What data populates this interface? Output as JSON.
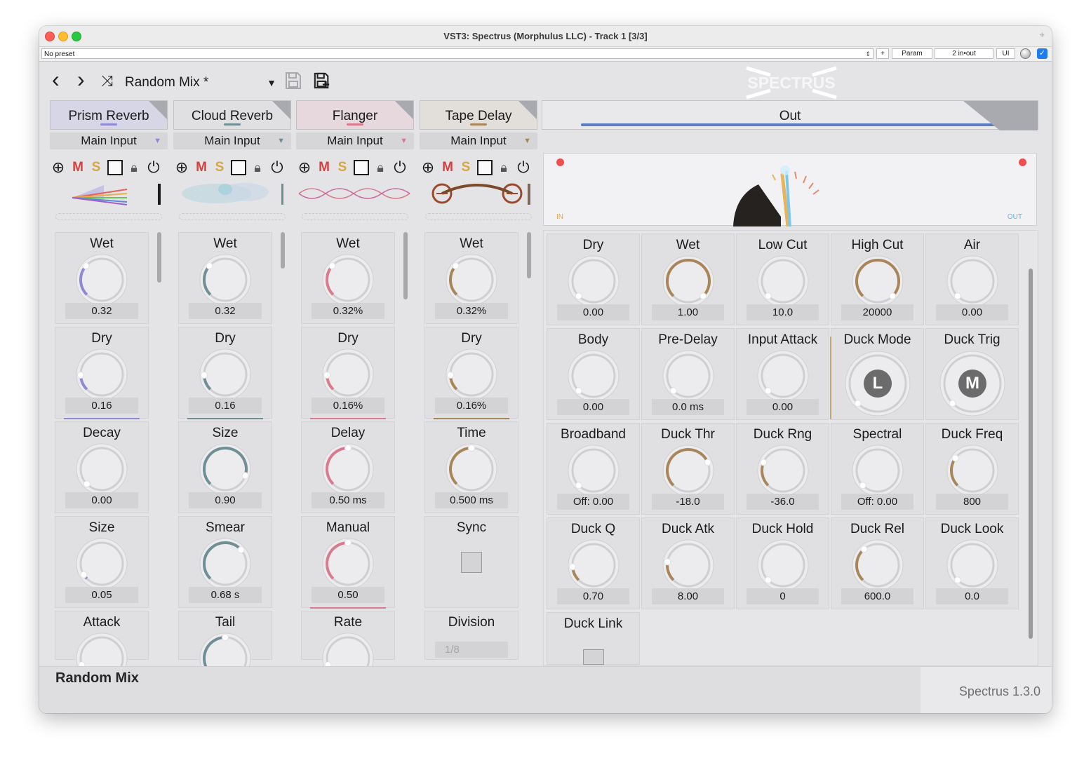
{
  "window": {
    "title": "VST3: Spectrus (Morphulus LLC) - Track 1 [3/3]"
  },
  "preset_bar": {
    "preset": "No preset",
    "plus": "+",
    "param": "Param",
    "io": "2 in•out",
    "ui": "UI"
  },
  "toolbar": {
    "mix_name": "Random Mix *",
    "logo_text": "SPECTRUS"
  },
  "colors": {
    "prism": "#8f8ad8",
    "cloud": "#6e8f93",
    "flanger": "#d97a8f",
    "tape": "#a9855a",
    "out_bar": "#5a7dc4",
    "mute": "#d64040",
    "solo": "#d6a640",
    "knob_gold": "#a9855a"
  },
  "modules": [
    {
      "name": "Prism Reverb",
      "input": "Main Input",
      "m": "M",
      "s": "S",
      "params": [
        {
          "label": "Wet",
          "value": "0.32"
        },
        {
          "label": "Dry",
          "value": "0.16"
        },
        {
          "label": "Decay",
          "value": "0.00"
        },
        {
          "label": "Size",
          "value": "0.05"
        },
        {
          "label": "Attack",
          "value": ""
        }
      ]
    },
    {
      "name": "Cloud Reverb",
      "input": "Main Input",
      "m": "M",
      "s": "S",
      "params": [
        {
          "label": "Wet",
          "value": "0.32"
        },
        {
          "label": "Dry",
          "value": "0.16"
        },
        {
          "label": "Size",
          "value": "0.90"
        },
        {
          "label": "Smear",
          "value": "0.68 s"
        },
        {
          "label": "Tail",
          "value": ""
        }
      ]
    },
    {
      "name": "Flanger",
      "input": "Main Input",
      "m": "M",
      "s": "S",
      "params": [
        {
          "label": "Wet",
          "value": "0.32%"
        },
        {
          "label": "Dry",
          "value": "0.16%"
        },
        {
          "label": "Delay",
          "value": "0.50 ms"
        },
        {
          "label": "Manual",
          "value": "0.50"
        },
        {
          "label": "Rate",
          "value": ""
        }
      ]
    },
    {
      "name": "Tape Delay",
      "input": "Main Input",
      "m": "M",
      "s": "S",
      "params": [
        {
          "label": "Wet",
          "value": "0.32%"
        },
        {
          "label": "Dry",
          "value": "0.16%"
        },
        {
          "label": "Time",
          "value": "0.500 ms"
        },
        {
          "label": "Sync",
          "value": ""
        },
        {
          "label": "Division",
          "value": "1/8"
        }
      ]
    }
  ],
  "out": {
    "name": "Out",
    "meter": {
      "in_label": "IN",
      "out_label": "OUT"
    },
    "params": [
      {
        "label": "Dry",
        "value": "0.00"
      },
      {
        "label": "Wet",
        "value": "1.00"
      },
      {
        "label": "Low Cut",
        "value": "10.0"
      },
      {
        "label": "High Cut",
        "value": "20000"
      },
      {
        "label": "Air",
        "value": "0.00"
      },
      {
        "label": "Body",
        "value": "0.00"
      },
      {
        "label": "Pre-Delay",
        "value": "0.0 ms"
      },
      {
        "label": "Input Attack",
        "value": "0.00"
      },
      {
        "label": "Duck Mode",
        "value": "L"
      },
      {
        "label": "Duck Trig",
        "value": "M"
      },
      {
        "label": "Broadband",
        "value": "Off: 0.00"
      },
      {
        "label": "Duck Thr",
        "value": "-18.0"
      },
      {
        "label": "Duck Rng",
        "value": "-36.0"
      },
      {
        "label": "Spectral",
        "value": "Off: 0.00"
      },
      {
        "label": "Duck Freq",
        "value": "800"
      },
      {
        "label": "Duck Q",
        "value": "0.70"
      },
      {
        "label": "Duck Atk",
        "value": "8.00"
      },
      {
        "label": "Duck Hold",
        "value": "0"
      },
      {
        "label": "Duck Rel",
        "value": "600.0"
      },
      {
        "label": "Duck Look",
        "value": "0.0"
      },
      {
        "label": "Duck Link",
        "value": ""
      }
    ]
  },
  "status": {
    "name": "Random Mix",
    "version": "Spectrus 1.3.0"
  }
}
